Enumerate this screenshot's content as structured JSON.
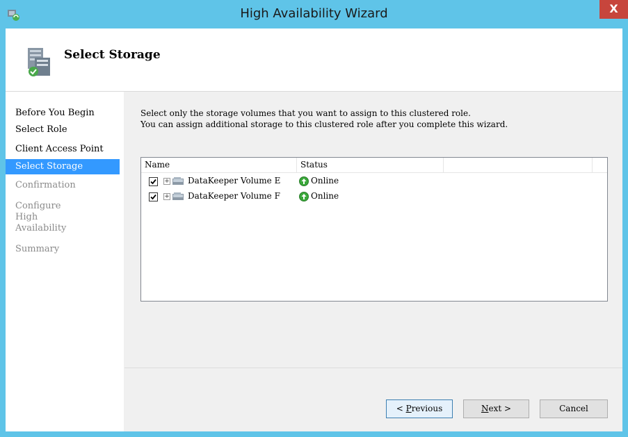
{
  "window": {
    "title": "High Availability Wizard",
    "close_label": "X"
  },
  "header": {
    "title": "Select Storage"
  },
  "sidebar": {
    "steps": [
      {
        "label": "Before You Begin",
        "state": "done"
      },
      {
        "label": "Select Role",
        "state": "done"
      },
      {
        "label": "Client Access Point",
        "state": "done"
      },
      {
        "label": "Select Storage",
        "state": "active"
      },
      {
        "label": "Confirmation",
        "state": "disabled"
      },
      {
        "label": "Configure High Availability",
        "state": "disabled"
      },
      {
        "label": "Summary",
        "state": "disabled"
      }
    ]
  },
  "main": {
    "description_line1": "Select only the storage volumes that you want to assign to this clustered role.",
    "description_line2": "You can assign additional storage to this clustered role after you complete this wizard.",
    "columns": {
      "name": "Name",
      "status": "Status"
    },
    "rows": [
      {
        "checked": true,
        "name": "DataKeeper Volume E",
        "status": "Online"
      },
      {
        "checked": true,
        "name": "DataKeeper Volume F",
        "status": "Online"
      }
    ]
  },
  "buttons": {
    "previous_prefix": "< ",
    "previous_key": "P",
    "previous_rest": "revious",
    "next_key": "N",
    "next_rest": "ext >",
    "cancel": "Cancel"
  },
  "colors": {
    "titlebar": "#5fc4e8",
    "active_step": "#3399ff",
    "close_button": "#c7453c",
    "online_icon": "#3aa83a"
  }
}
